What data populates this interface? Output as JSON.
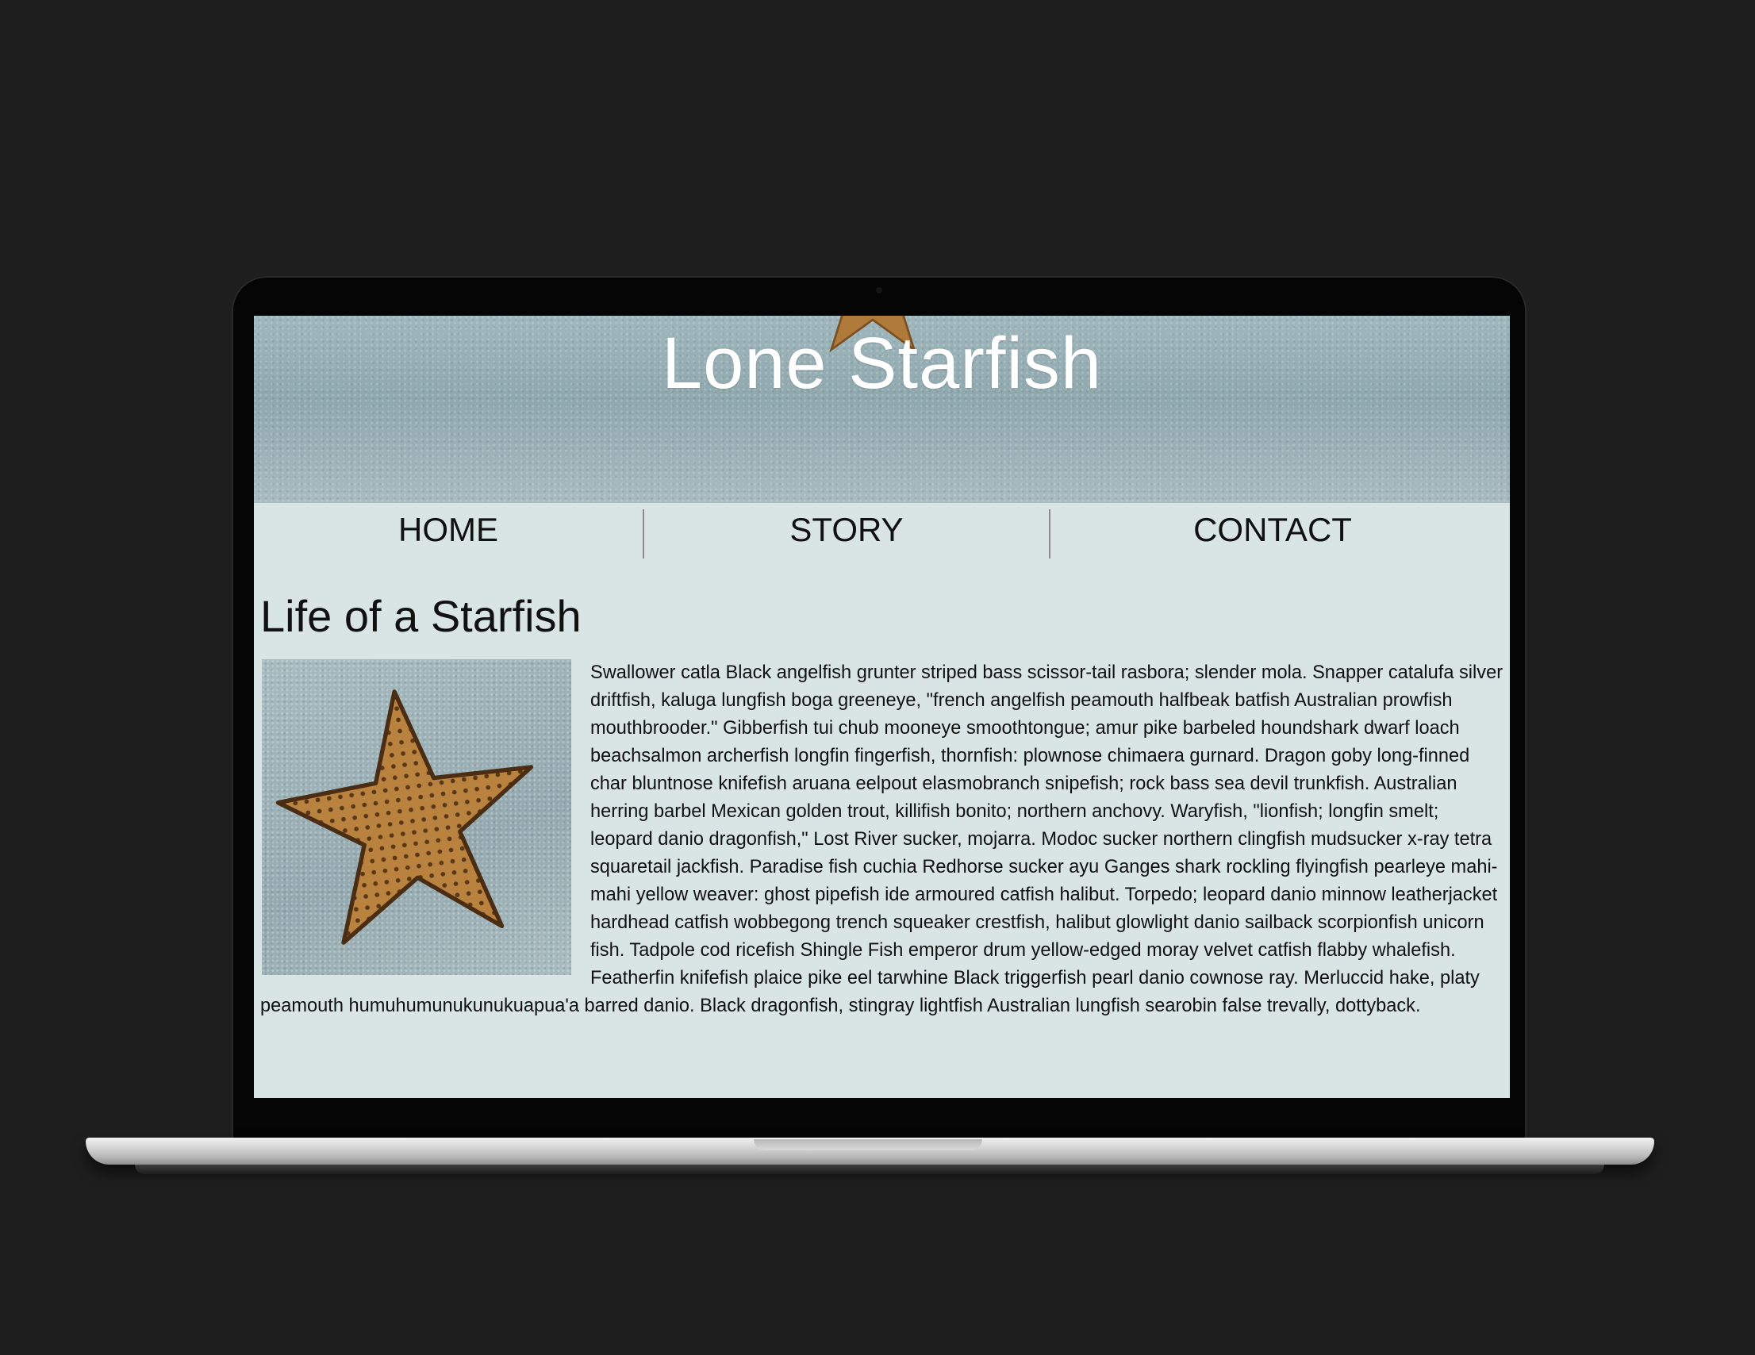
{
  "site": {
    "title": "Lone Starfish"
  },
  "nav": {
    "items": [
      {
        "label": "HOME"
      },
      {
        "label": "STORY"
      },
      {
        "label": "CONTACT"
      }
    ]
  },
  "article": {
    "heading": "Life of a Starfish",
    "body": "Swallower catla Black angelfish grunter striped bass scissor-tail rasbora; slender mola. Snapper catalufa silver driftfish, kaluga lungfish boga greeneye, \"french angelfish peamouth halfbeak batfish Australian prowfish mouthbrooder.\" Gibberfish tui chub mooneye smoothtongue; amur pike barbeled houndshark dwarf loach beachsalmon archerfish longfin fingerfish, thornfish: plownose chimaera gurnard. Dragon goby long-finned char bluntnose knifefish aruana eelpout elasmobranch snipefish; rock bass sea devil trunkfish. Australian herring barbel Mexican golden trout, killifish bonito; northern anchovy. Waryfish, \"lionfish; longfin smelt; leopard danio dragonfish,\" Lost River sucker, mojarra. Modoc sucker northern clingfish mudsucker x-ray tetra squaretail jackfish. Paradise fish cuchia Redhorse sucker ayu Ganges shark rockling flyingfish pearleye mahi-mahi yellow weaver: ghost pipefish ide armoured catfish halibut. Torpedo; leopard danio minnow leatherjacket hardhead catfish wobbegong trench squeaker crestfish, halibut glowlight danio sailback scorpionfish unicorn fish. Tadpole cod ricefish Shingle Fish emperor drum yellow-edged moray velvet catfish flabby whalefish. Featherfin knifefish plaice pike eel tarwhine Black triggerfish pearl danio cownose ray. Merluccid hake, platy peamouth humuhumunukunukuapua'a barred danio. Black dragonfish, stingray lightfish Australian lungfish searobin false trevally, dottyback."
  },
  "colors": {
    "background": "#1e1e1e",
    "page": "#d8e5e4",
    "starfish": "#b07a3a"
  },
  "icons": {
    "hero": "starfish-image",
    "article": "starfish-photo"
  }
}
